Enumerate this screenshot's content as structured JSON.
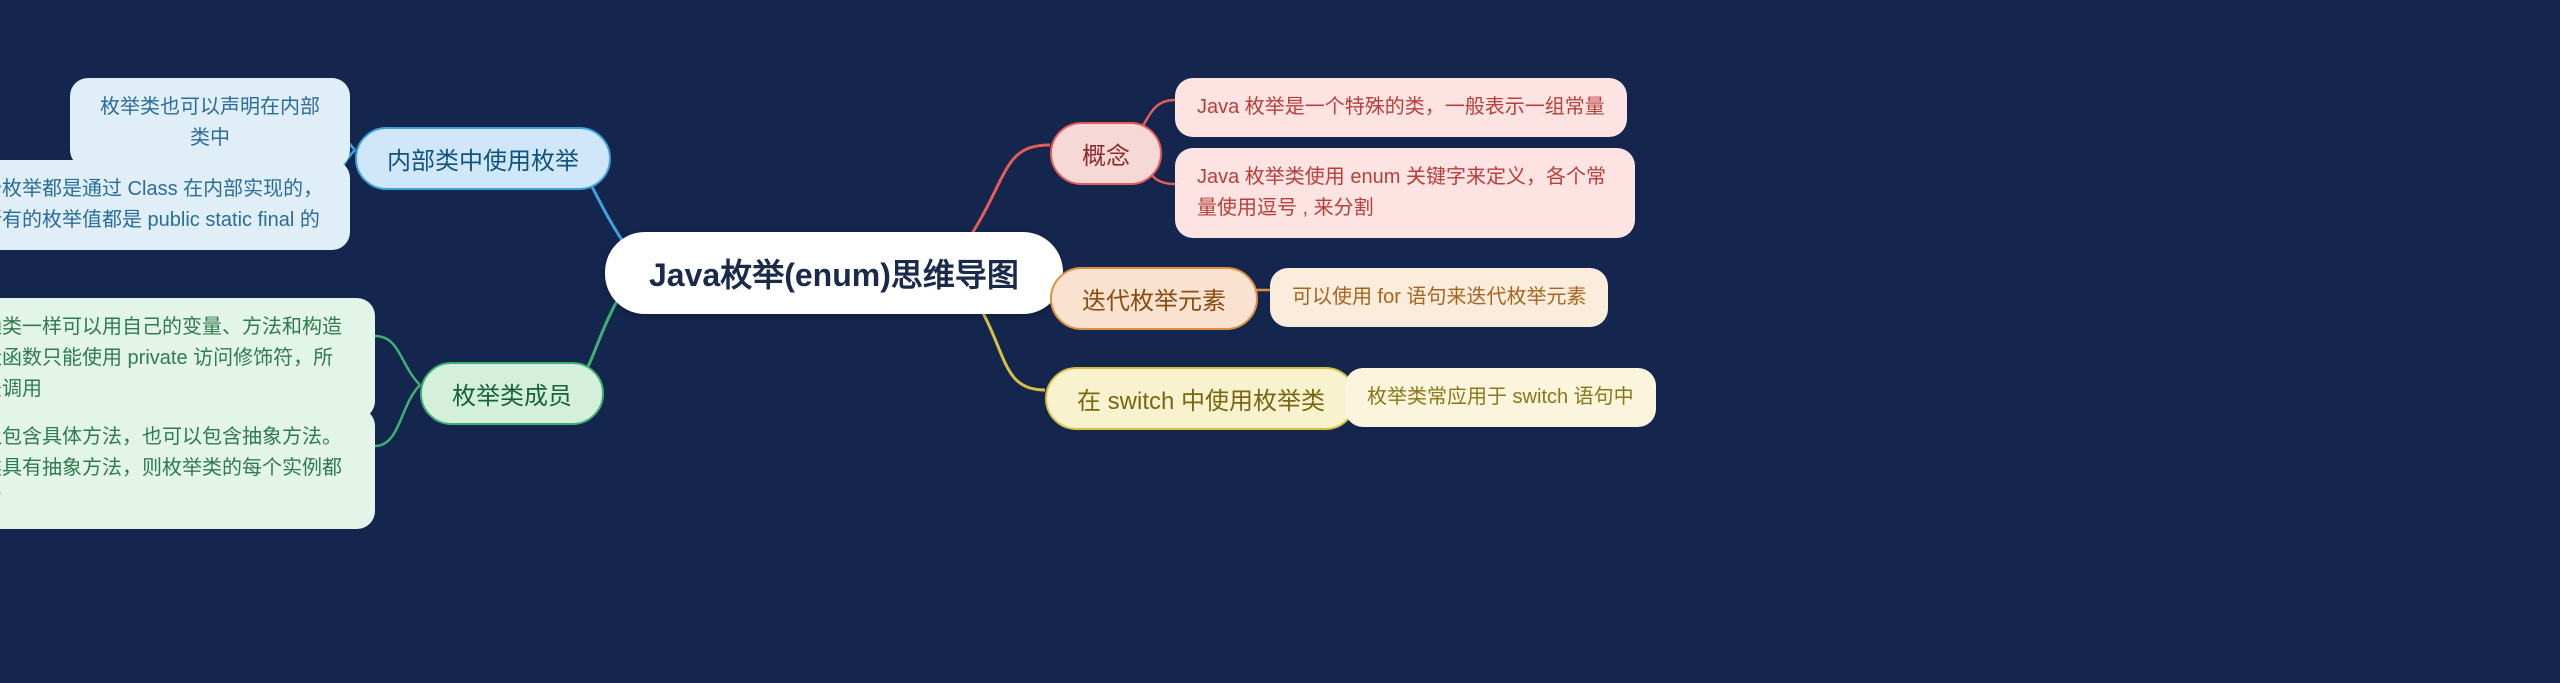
{
  "root": {
    "title": "Java枚举(enum)思维导图"
  },
  "branches": {
    "concept": {
      "label": "概念",
      "leaves": [
        "Java 枚举是一个特殊的类，一般表示一组常量",
        "Java 枚举类使用 enum 关键字来定义，各个常量使用逗号 , 来分割"
      ]
    },
    "iterate": {
      "label": "迭代枚举元素",
      "leaves": [
        "可以使用 for 语句来迭代枚举元素"
      ]
    },
    "switch": {
      "label": "在 switch 中使用枚举类",
      "leaves": [
        "枚举类常应用于 switch 语句中"
      ]
    },
    "inner": {
      "label": "内部类中使用枚举",
      "leaves": [
        "枚举类也可以声明在内部类中",
        "每个枚举都是通过 Class 在内部实现的，且所有的枚举值都是 public static final 的"
      ]
    },
    "members": {
      "label": "枚举类成员",
      "leaves": [
        "枚举跟普通类一样可以用自己的变量、方法和构造函数，构造函数只能使用 private 访问修饰符，所以外部无法调用",
        "枚举既可以包含具体方法，也可以包含抽象方法。如果枚举类具有抽象方法，则枚举类的每个实例都必须实现它"
      ]
    }
  }
}
